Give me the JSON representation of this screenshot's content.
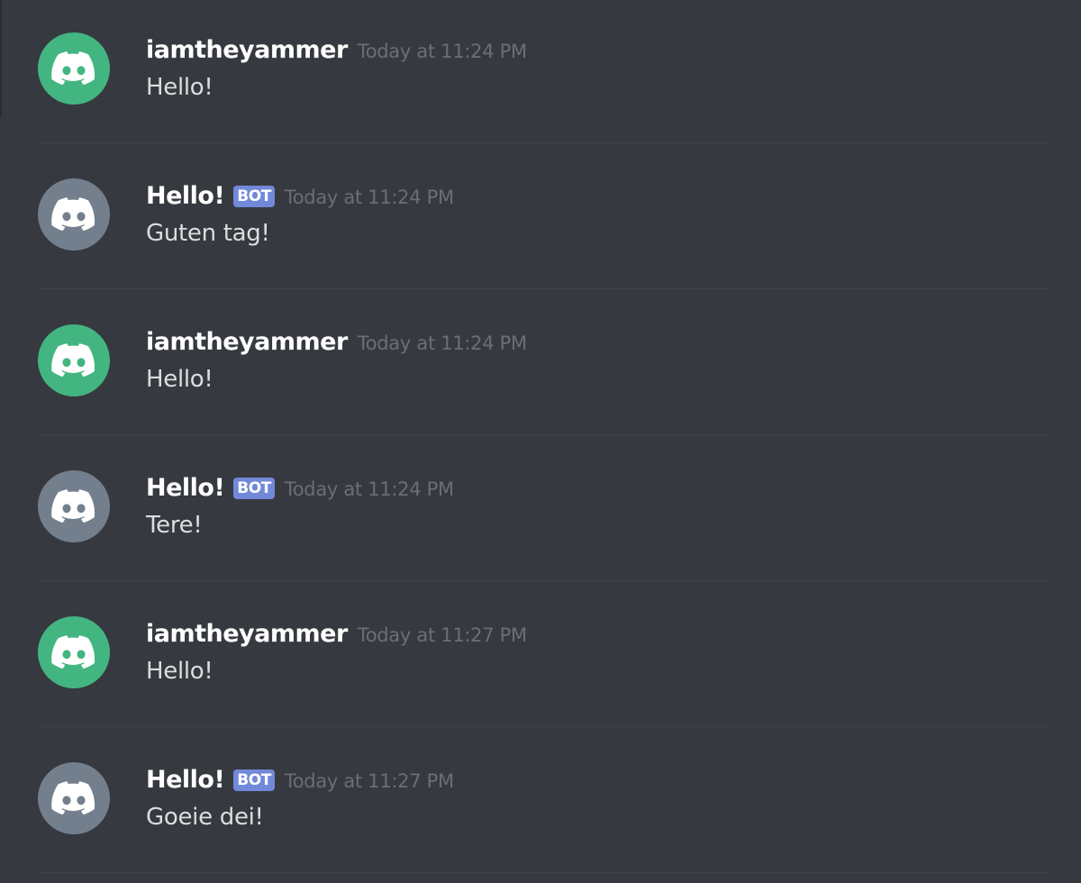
{
  "colors": {
    "background": "#36393f",
    "user_avatar": "#43b581",
    "bot_avatar": "#747f8d",
    "bot_tag": "#7289da"
  },
  "messages": [
    {
      "author": "iamtheyammer",
      "bot": false,
      "bot_tag": "",
      "timestamp": "Today at 11:24 PM",
      "content": "Hello!",
      "avatar_icon": "discord-logo-icon"
    },
    {
      "author": "Hello!",
      "bot": true,
      "bot_tag": "BOT",
      "timestamp": "Today at 11:24 PM",
      "content": "Guten tag!",
      "avatar_icon": "discord-logo-icon"
    },
    {
      "author": "iamtheyammer",
      "bot": false,
      "bot_tag": "",
      "timestamp": "Today at 11:24 PM",
      "content": "Hello!",
      "avatar_icon": "discord-logo-icon"
    },
    {
      "author": "Hello!",
      "bot": true,
      "bot_tag": "BOT",
      "timestamp": "Today at 11:24 PM",
      "content": "Tere!",
      "avatar_icon": "discord-logo-icon"
    },
    {
      "author": "iamtheyammer",
      "bot": false,
      "bot_tag": "",
      "timestamp": "Today at 11:27 PM",
      "content": "Hello!",
      "avatar_icon": "discord-logo-icon"
    },
    {
      "author": "Hello!",
      "bot": true,
      "bot_tag": "BOT",
      "timestamp": "Today at 11:27 PM",
      "content": "Goeie dei!",
      "avatar_icon": "discord-logo-icon"
    }
  ]
}
